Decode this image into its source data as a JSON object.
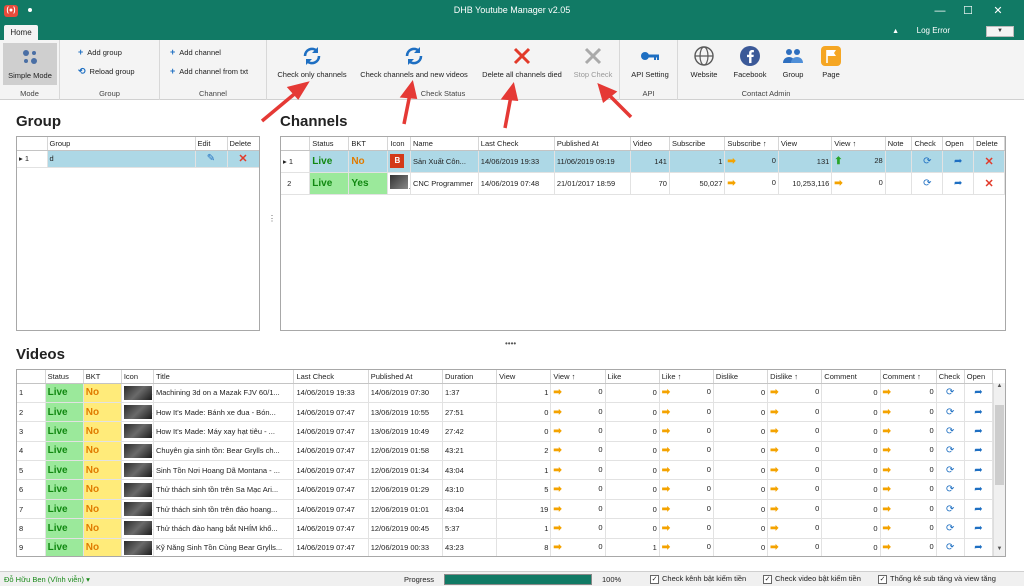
{
  "app": {
    "title": "DHB Youtube Manager v2.05",
    "icon_text": "(●)",
    "window_buttons": [
      "—",
      "☐",
      "✕"
    ]
  },
  "tabs": {
    "home": "Home",
    "log_error": "Log Error",
    "log_error_dropdown": "▼"
  },
  "ribbon": {
    "mode": {
      "caption": "Mode",
      "simple_mode": "Simple Mode"
    },
    "group": {
      "caption": "Group",
      "add_group": "Add group",
      "reload_group": "Reload group"
    },
    "channel": {
      "caption": "Channel",
      "add_channel": "Add channel",
      "add_channel_from_txt": "Add channel from txt"
    },
    "check_status": {
      "caption": "Check Status",
      "check_only_channels": "Check only channels",
      "check_channels_and_new_videos": "Check channels and new videos",
      "delete_all_channels_died": "Delete all channels died",
      "stop_check": "Stop Check"
    },
    "api": {
      "caption": "API",
      "api_setting": "API Setting"
    },
    "contact": {
      "caption": "Contact Admin",
      "website": "Website",
      "facebook": "Facebook",
      "group": "Group",
      "page": "Page"
    },
    "colors": {
      "accent": "#117a65",
      "arrow_red": "#e53935"
    }
  },
  "group_panel": {
    "title": "Group",
    "headers": [
      "",
      "Group",
      "Edit",
      "Delete"
    ],
    "rows": [
      {
        "index": "1",
        "name": "d"
      }
    ]
  },
  "channels_panel": {
    "title": "Channels",
    "headers": [
      "",
      "Status",
      "BKT",
      "Icon",
      "Name",
      "Last Check",
      "Published At",
      "Video",
      "Subscribe",
      "Subscribe ↑",
      "View",
      "View ↑",
      "Note",
      "Check",
      "Open",
      "Delete"
    ],
    "rows": [
      {
        "index": "1",
        "status": "Live",
        "bkt": "No",
        "icon": "B",
        "name": "Sản Xuất Côn...",
        "last_check": "14/06/2019 19:33",
        "published": "11/06/2019 09:19",
        "video": "141",
        "subscribe": "1",
        "subscribe_up": "0",
        "view": "131",
        "view_up": "28",
        "note": ""
      },
      {
        "index": "2",
        "status": "Live",
        "bkt": "Yes",
        "icon": "",
        "name": "CNC Programmer",
        "last_check": "14/06/2019 07:48",
        "published": "21/01/2017 18:59",
        "video": "70",
        "subscribe": "50,027",
        "subscribe_up": "0",
        "view": "10,253,116",
        "view_up": "0",
        "note": ""
      }
    ]
  },
  "videos_panel": {
    "title": "Videos",
    "headers": [
      "",
      "Status",
      "BKT",
      "Icon",
      "Title",
      "Last Check",
      "Published At",
      "Duration",
      "View",
      "View ↑",
      "Like",
      "Like ↑",
      "Dislike",
      "Dislike ↑",
      "Comment",
      "Comment ↑",
      "Check",
      "Open"
    ],
    "rows": [
      {
        "index": "1",
        "status": "Live",
        "bkt": "No",
        "title": "Machining 3d on a Mazak FJV 60/1...",
        "last_check": "14/06/2019 19:33",
        "published": "14/06/2019 07:30",
        "duration": "1:37",
        "view": "1",
        "view_up": "0",
        "like": "0",
        "like_up": "0",
        "dislike": "0",
        "dislike_up": "0",
        "comment": "0",
        "comment_up": "0"
      },
      {
        "index": "2",
        "status": "Live",
        "bkt": "No",
        "title": "How It's Made: Bánh xe đua - Bón...",
        "last_check": "14/06/2019 07:47",
        "published": "13/06/2019 10:55",
        "duration": "27:51",
        "view": "0",
        "view_up": "0",
        "like": "0",
        "like_up": "0",
        "dislike": "0",
        "dislike_up": "0",
        "comment": "0",
        "comment_up": "0"
      },
      {
        "index": "3",
        "status": "Live",
        "bkt": "No",
        "title": "How It's Made: Máy xay hạt tiêu - ...",
        "last_check": "14/06/2019 07:47",
        "published": "13/06/2019 10:49",
        "duration": "27:42",
        "view": "0",
        "view_up": "0",
        "like": "0",
        "like_up": "0",
        "dislike": "0",
        "dislike_up": "0",
        "comment": "0",
        "comment_up": "0"
      },
      {
        "index": "4",
        "status": "Live",
        "bkt": "No",
        "title": "Chuyên gia sinh tồn: Bear Grylls ch...",
        "last_check": "14/06/2019 07:47",
        "published": "12/06/2019 01:58",
        "duration": "43:21",
        "view": "2",
        "view_up": "0",
        "like": "0",
        "like_up": "0",
        "dislike": "0",
        "dislike_up": "0",
        "comment": "0",
        "comment_up": "0"
      },
      {
        "index": "5",
        "status": "Live",
        "bkt": "No",
        "title": "Sinh Tồn Nơi Hoang Dã Montana - ...",
        "last_check": "14/06/2019 07:47",
        "published": "12/06/2019 01:34",
        "duration": "43:04",
        "view": "1",
        "view_up": "0",
        "like": "0",
        "like_up": "0",
        "dislike": "0",
        "dislike_up": "0",
        "comment": "0",
        "comment_up": "0"
      },
      {
        "index": "6",
        "status": "Live",
        "bkt": "No",
        "title": "Thử thách sinh tồn trên Sa Mạc Ari...",
        "last_check": "14/06/2019 07:47",
        "published": "12/06/2019 01:29",
        "duration": "43:10",
        "view": "5",
        "view_up": "0",
        "like": "0",
        "like_up": "0",
        "dislike": "0",
        "dislike_up": "0",
        "comment": "0",
        "comment_up": "0"
      },
      {
        "index": "7",
        "status": "Live",
        "bkt": "No",
        "title": "Thử thách sinh tồn trên đảo hoang...",
        "last_check": "14/06/2019 07:47",
        "published": "12/06/2019 01:01",
        "duration": "43:04",
        "view": "19",
        "view_up": "0",
        "like": "0",
        "like_up": "0",
        "dislike": "0",
        "dislike_up": "0",
        "comment": "0",
        "comment_up": "0"
      },
      {
        "index": "8",
        "status": "Live",
        "bkt": "No",
        "title": "Thử thách đào hang bắt NHÍM khổ...",
        "last_check": "14/06/2019 07:47",
        "published": "12/06/2019 00:45",
        "duration": "5:37",
        "view": "1",
        "view_up": "0",
        "like": "0",
        "like_up": "0",
        "dislike": "0",
        "dislike_up": "0",
        "comment": "0",
        "comment_up": "0"
      },
      {
        "index": "9",
        "status": "Live",
        "bkt": "No",
        "title": "Kỹ Năng Sinh Tồn Cùng Bear Grylls...",
        "last_check": "14/06/2019 07:47",
        "published": "12/06/2019 00:33",
        "duration": "43:23",
        "view": "8",
        "view_up": "0",
        "like": "1",
        "like_up": "0",
        "dislike": "0",
        "dislike_up": "0",
        "comment": "0",
        "comment_up": "0"
      }
    ]
  },
  "statusbar": {
    "user": "Đỗ Hữu Ben (Vĩnh viễn)",
    "progress_label": "Progress",
    "zoom": "100%",
    "check_channel_monetized": "Check kênh bật kiếm tiền",
    "check_video_monetized": "Check video bật kiếm tiền",
    "stats_sub_view": "Thống kê sub tăng và view tăng"
  },
  "icons": {
    "refresh": "refresh-icon",
    "delete": "close-icon",
    "stop": "stop-icon",
    "key": "key-icon",
    "web": "globe-icon",
    "facebook": "facebook-icon",
    "group": "people-icon",
    "page": "flag-icon"
  }
}
